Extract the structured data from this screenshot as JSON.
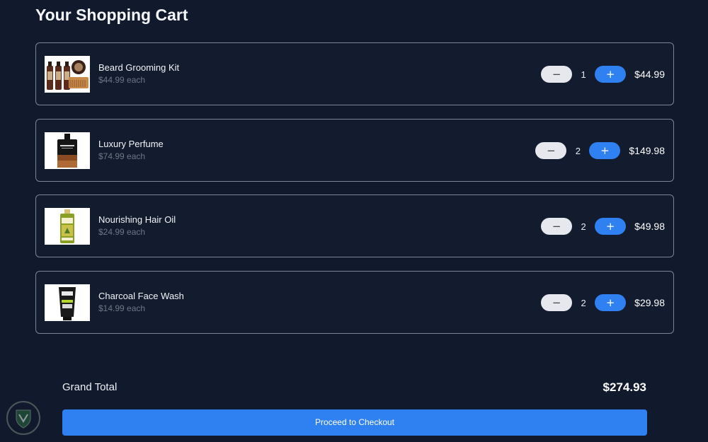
{
  "page": {
    "title": "Your Shopping Cart"
  },
  "items": [
    {
      "name": "Beard Grooming Kit",
      "unit_price": "$44.99 each",
      "quantity": "1",
      "total": "$44.99",
      "image": "beard-kit-image"
    },
    {
      "name": "Luxury Perfume",
      "unit_price": "$74.99 each",
      "quantity": "2",
      "total": "$149.98",
      "image": "perfume-image"
    },
    {
      "name": "Nourishing Hair Oil",
      "unit_price": "$24.99 each",
      "quantity": "2",
      "total": "$49.98",
      "image": "hair-oil-image"
    },
    {
      "name": "Charcoal Face Wash",
      "unit_price": "$14.99 each",
      "quantity": "2",
      "total": "$29.98",
      "image": "face-wash-image"
    }
  ],
  "controls": {
    "minus_label": "−",
    "plus_label": "+"
  },
  "summary": {
    "grand_total_label": "Grand Total",
    "grand_total_value": "$274.93",
    "checkout_label": "Proceed to Checkout"
  },
  "colors": {
    "background": "#111a2d",
    "accent": "#2f80f0",
    "card_border": "#7b8496"
  }
}
